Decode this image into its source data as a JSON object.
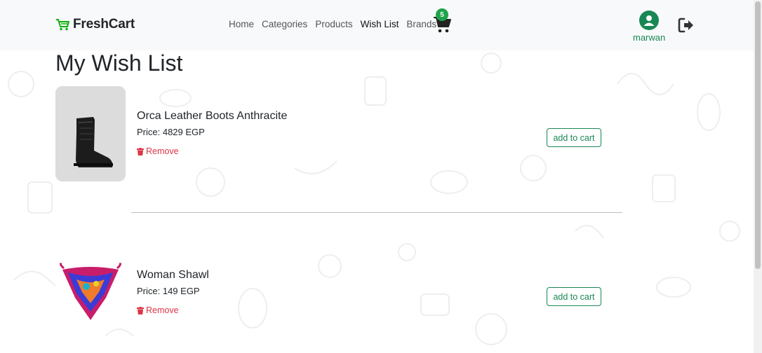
{
  "navbar": {
    "brand": "FreshCart",
    "links": [
      {
        "label": "Home",
        "active": false
      },
      {
        "label": "Categories",
        "active": false
      },
      {
        "label": "Products",
        "active": false
      },
      {
        "label": "Wish List",
        "active": true
      },
      {
        "label": "Brands",
        "active": false
      }
    ],
    "cart_count": "5",
    "username": "marwan"
  },
  "page": {
    "title": "My Wish List"
  },
  "wishlist": [
    {
      "name": "Orca Leather Boots Anthracite",
      "price": "Price: 4829 EGP",
      "remove_label": "Remove",
      "add_label": "add to cart"
    },
    {
      "name": "Woman Shawl",
      "price": "Price: 149 EGP",
      "remove_label": "Remove",
      "add_label": "add to cart"
    }
  ],
  "colors": {
    "brand_green": "#198754",
    "badge_green": "#1fa34a",
    "remove_red": "#dc3545",
    "navbar_bg": "#f8f9fa"
  }
}
